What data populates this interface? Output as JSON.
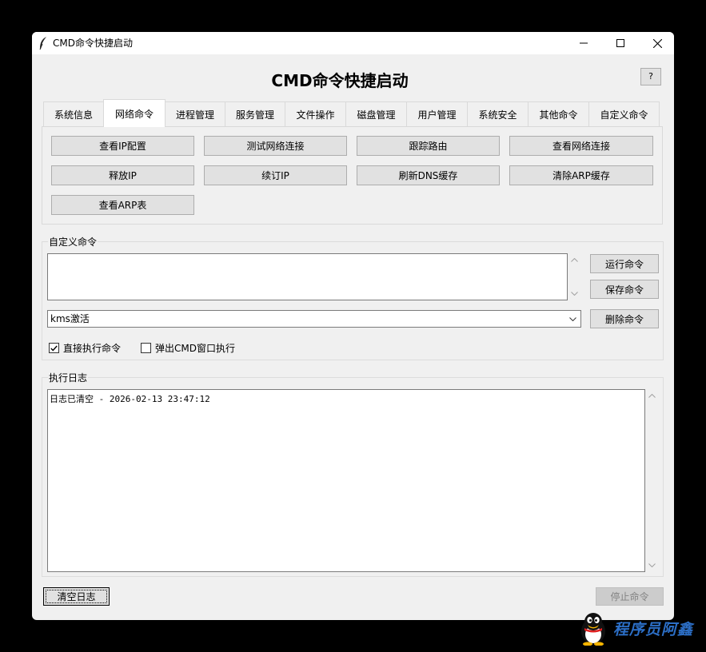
{
  "window": {
    "title": "CMD命令快捷启动"
  },
  "header": {
    "title": "CMD命令快捷启动",
    "help_label": "?"
  },
  "tabs": [
    {
      "label": "系统信息"
    },
    {
      "label": "网络命令"
    },
    {
      "label": "进程管理"
    },
    {
      "label": "服务管理"
    },
    {
      "label": "文件操作"
    },
    {
      "label": "磁盘管理"
    },
    {
      "label": "用户管理"
    },
    {
      "label": "系统安全"
    },
    {
      "label": "其他命令"
    },
    {
      "label": "自定义命令"
    }
  ],
  "active_tab": "网络命令",
  "network_buttons": [
    {
      "label": "查看IP配置"
    },
    {
      "label": "测试网络连接"
    },
    {
      "label": "跟踪路由"
    },
    {
      "label": "查看网络连接"
    },
    {
      "label": "释放IP"
    },
    {
      "label": "续订IP"
    },
    {
      "label": "刷新DNS缓存"
    },
    {
      "label": "清除ARP缓存"
    },
    {
      "label": "查看ARP表"
    }
  ],
  "custom": {
    "group_label": "自定义命令",
    "command_text": "",
    "run_label": "运行命令",
    "save_label": "保存命令",
    "delete_label": "删除命令",
    "selected_command": "kms激活",
    "direct_exec": {
      "label": "直接执行命令",
      "checked": true
    },
    "popup_cmd": {
      "label": "弹出CMD窗口执行",
      "checked": false
    }
  },
  "log": {
    "group_label": "执行日志",
    "lines": [
      "日志已清空 - 2026-02-13 23:47:12"
    ]
  },
  "footer": {
    "clear_label": "清空日志",
    "stop_label": "停止命令"
  },
  "watermark": {
    "text": "程序员阿鑫"
  },
  "icons": {
    "app": "feather-icon",
    "minimize": "minimize-icon",
    "maximize": "maximize-icon",
    "close": "close-icon",
    "dropdown": "chevron-down-icon",
    "scroll_up": "scroll-up-icon",
    "scroll_down": "scroll-down-icon",
    "watermark": "penguin-icon"
  }
}
